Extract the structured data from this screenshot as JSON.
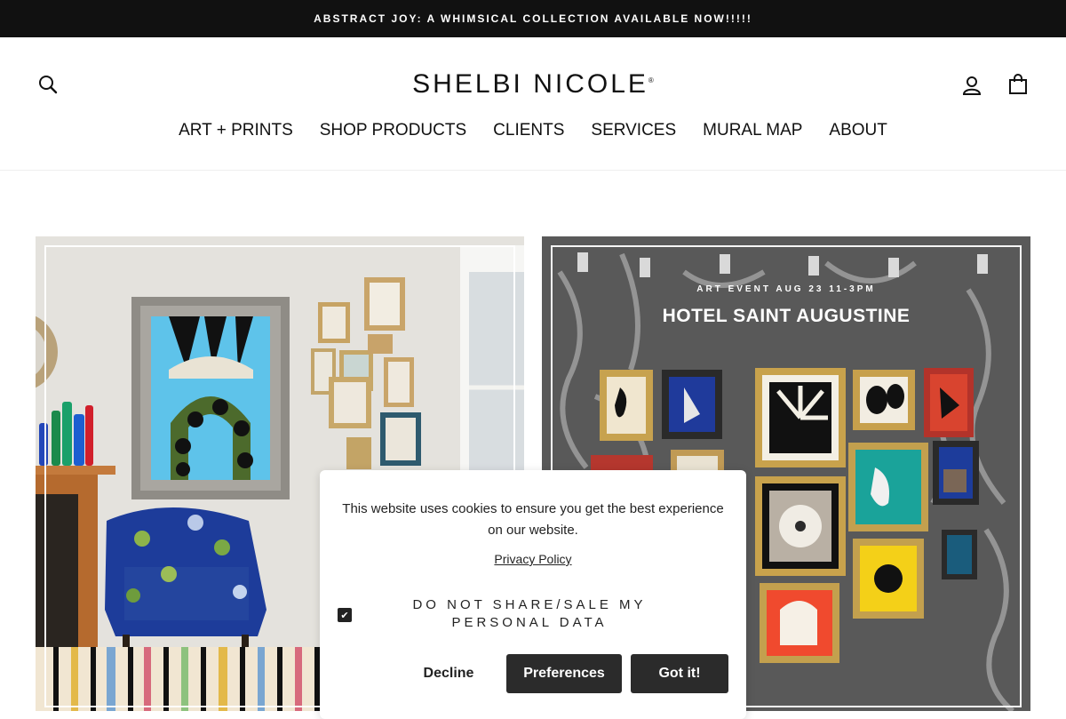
{
  "announcement": "ABSTRACT JOY: A WHIMSICAL COLLECTION AVAILABLE NOW!!!!!",
  "header": {
    "logo": "SHELBI NICOLE",
    "logo_mark": "®",
    "icons": [
      "search-icon",
      "account-icon",
      "cart-icon"
    ]
  },
  "nav": [
    "ART + PRINTS",
    "SHOP PRODUCTS",
    "CLIENTS",
    "SERVICES",
    "MURAL MAP",
    "ABOUT"
  ],
  "event": {
    "kicker": "ART EVENT AUG 23 11-3PM",
    "title": "HOTEL SAINT AUGUSTINE"
  },
  "cookie": {
    "message": "This website uses cookies to ensure you get the best experience on our website.",
    "privacy_link": "Privacy Policy",
    "opt_out_label": "DO NOT SHARE/SALE MY PERSONAL DATA",
    "opt_out_checked": true,
    "buttons": {
      "decline": "Decline",
      "preferences": "Preferences",
      "accept": "Got it!"
    }
  }
}
